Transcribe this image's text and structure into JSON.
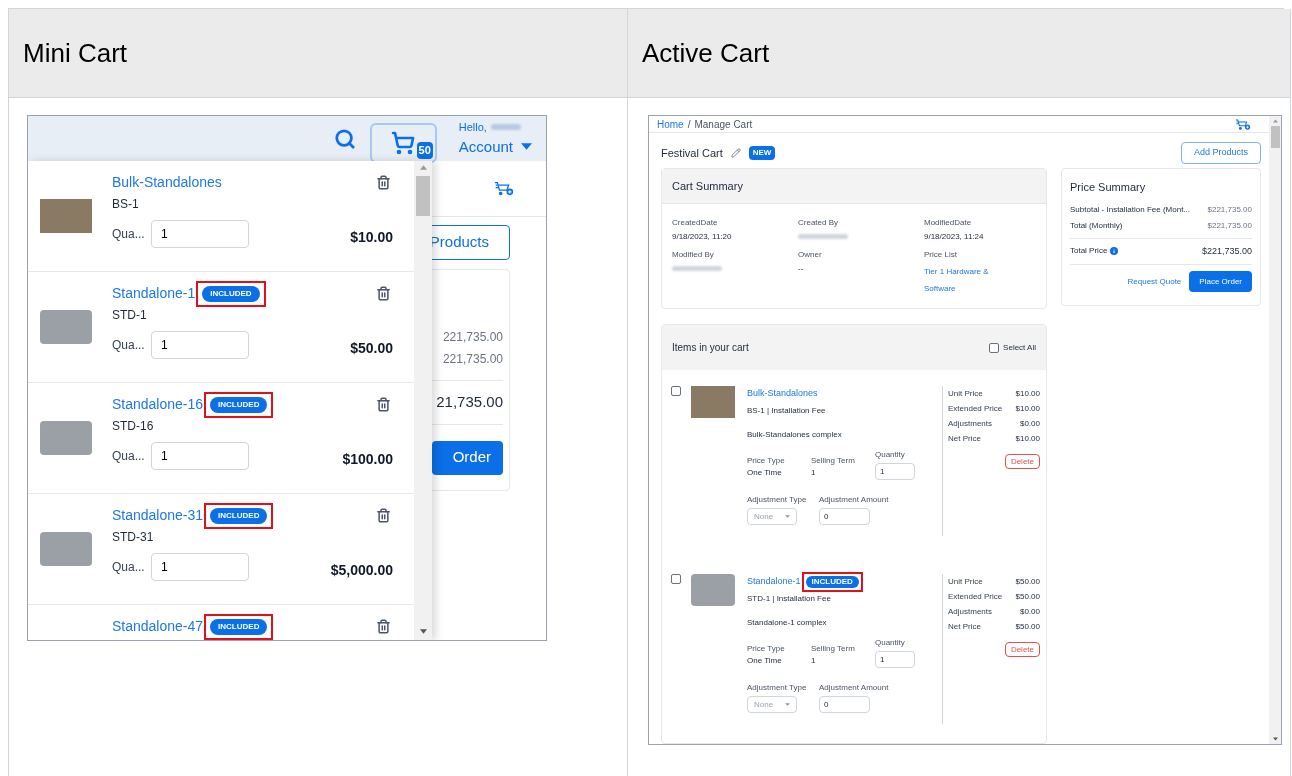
{
  "table": {
    "columns": [
      {
        "title": "Mini Cart"
      },
      {
        "title": "Active Cart"
      }
    ]
  },
  "mini_cart": {
    "header": {
      "greeting": "Hello,",
      "name_hidden": true,
      "account": "Account",
      "cart_count": "50"
    },
    "background_page": {
      "button": "Products",
      "amounts": [
        "221,735.00",
        "221,735.00"
      ],
      "total": "21,735.00",
      "order_button": "Order"
    },
    "items": [
      {
        "name": "Bulk-Standalones",
        "sku": "BS-1",
        "qty_label": "Qua...",
        "qty": "1",
        "price": "$10.00"
      },
      {
        "name": "Standalone-1",
        "badge": "INCLUDED",
        "highlighted": true,
        "sku": "STD-1",
        "qty_label": "Qua...",
        "qty": "1",
        "price": "$50.00"
      },
      {
        "name": "Standalone-16",
        "badge": "INCLUDED",
        "highlighted": true,
        "sku": "STD-16",
        "qty_label": "Qua...",
        "qty": "1",
        "price": "$100.00"
      },
      {
        "name": "Standalone-31",
        "badge": "INCLUDED",
        "highlighted": true,
        "sku": "STD-31",
        "qty_label": "Qua...",
        "qty": "1",
        "price": "$5,000.00"
      },
      {
        "name": "Standalone-47",
        "badge": "INCLUDED",
        "highlighted": true
      }
    ]
  },
  "active_cart": {
    "breadcrumb": [
      {
        "label": "Home",
        "link": true
      },
      {
        "label": "Manage Cart",
        "link": false
      }
    ],
    "breadcrumb_separator": "/",
    "title": "Festival Cart",
    "status": "NEW",
    "add_button": "Add Products",
    "cart_summary": {
      "title": "Cart Summary",
      "fields": [
        {
          "label": "CreatedDate",
          "kind": "text",
          "value": "9/18/2023, 11:20"
        },
        {
          "label": "Created By",
          "kind": "redacted"
        },
        {
          "label": "ModifiedDate",
          "kind": "text",
          "value": "9/18/2023, 11:24"
        },
        {
          "label": "Modified By",
          "kind": "redacted"
        },
        {
          "label": "Owner",
          "kind": "text",
          "value": "--"
        },
        {
          "label": "Price List",
          "kind": "link",
          "value": "Tier 1 Hardware & Software"
        }
      ]
    },
    "price_summary": {
      "title": "Price Summary",
      "lines": [
        {
          "label": "Subtotal - Installation Fee (Mont...",
          "value": "$221,735.00"
        },
        {
          "label": "Total (Monthly)",
          "value": "$221,735.00"
        }
      ],
      "total_label": "Total Price",
      "total": "$221,735.00",
      "request_button": "Request Quote",
      "order_button": "Place Order"
    },
    "items_card": {
      "title": "Items in your cart",
      "select_all": {
        "label": "Select All",
        "checked": false
      },
      "items": [
        {
          "checked": false,
          "name": "Bulk-Standalones",
          "subtitle": "BS-1 | Installation Fee",
          "description": "Bulk-Standalones complex",
          "price_type_label": "Price Type",
          "price_type": "One Time",
          "selling_term_label": "Selling Term",
          "selling_term": "1",
          "quantity_label": "Quantity",
          "quantity": "1",
          "adjustment_type_label": "Adjustment Type",
          "adjustment_type": "None",
          "adjustment_amount_label": "Adjustment Amount",
          "adjustment_amount": "0",
          "prices": [
            {
              "label": "Unit Price",
              "value": "$10.00"
            },
            {
              "label": "Extended Price",
              "value": "$10.00"
            },
            {
              "label": "Adjustments",
              "value": "$0.00"
            },
            {
              "label": "Net Price",
              "value": "$10.00"
            }
          ],
          "delete": "Delete"
        },
        {
          "checked": false,
          "name": "Standalone-1",
          "badge": "INCLUDED",
          "highlighted": true,
          "subtitle": "STD-1 | Installation Fee",
          "description": "Standalone-1 complex",
          "price_type_label": "Price Type",
          "price_type": "One Time",
          "selling_term_label": "Selling Term",
          "selling_term": "1",
          "quantity_label": "Quantity",
          "quantity": "1",
          "adjustment_type_label": "Adjustment Type",
          "adjustment_type": "None",
          "adjustment_amount_label": "Adjustment Amount",
          "adjustment_amount": "0",
          "prices": [
            {
              "label": "Unit Price",
              "value": "$50.00"
            },
            {
              "label": "Extended Price",
              "value": "$50.00"
            },
            {
              "label": "Adjustments",
              "value": "$0.00"
            },
            {
              "label": "Net Price",
              "value": "$50.00"
            }
          ],
          "delete": "Delete"
        }
      ]
    }
  }
}
